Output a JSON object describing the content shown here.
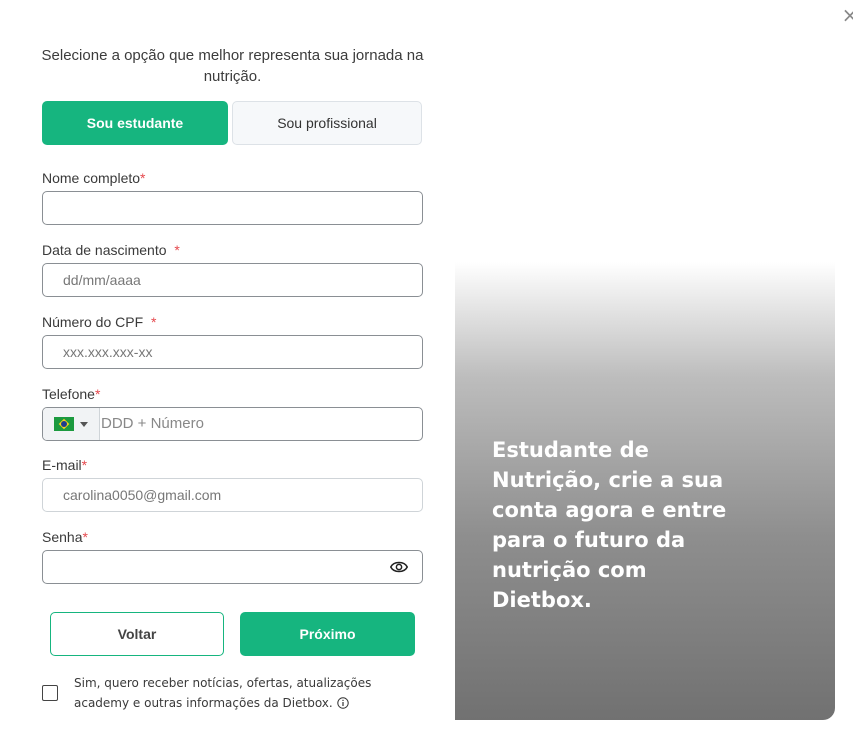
{
  "close_label": "×",
  "intro": "Selecione a opção que melhor representa sua jornada na nutrição.",
  "toggle": {
    "student": "Sou estudante",
    "professional": "Sou profissional",
    "selected": "student"
  },
  "fields": {
    "name": {
      "label": "Nome completo",
      "required": "*",
      "value": ""
    },
    "birth": {
      "label": "Data de nascimento",
      "required": "*",
      "placeholder": "dd/mm/aaaa"
    },
    "cpf": {
      "label": "Número do CPF",
      "required": "*",
      "placeholder": "xxx.xxx.xxx-xx"
    },
    "phone": {
      "label": "Telefone",
      "required": "*",
      "country": "brazil-flag-icon",
      "placeholder": "DDD + Número"
    },
    "email": {
      "label": "E-mail",
      "required": "*",
      "value": "carolina0050@gmail.com"
    },
    "password": {
      "label": "Senha",
      "required": "*",
      "value": ""
    }
  },
  "buttons": {
    "back": "Voltar",
    "next": "Próximo"
  },
  "consent": "Sim, quero receber notícias, ofertas, atualizações academy e outras informações da Dietbox.",
  "promo": "Estudante de Nutrição, crie a sua conta agora e entre para o futuro da nutrição com Dietbox.",
  "colors": {
    "accent": "#16b57f",
    "required": "#e5484d"
  }
}
